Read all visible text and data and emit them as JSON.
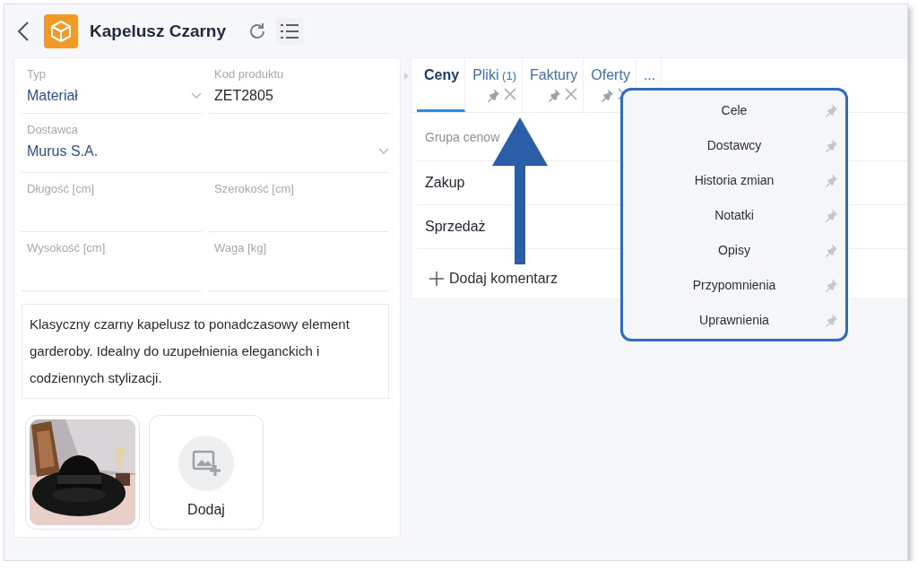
{
  "header": {
    "title": "Kapelusz Czarny"
  },
  "field_rows": [
    [
      {
        "label": "Typ",
        "kind": "select",
        "value": "Materiał"
      },
      {
        "label": "Kod produktu",
        "kind": "text",
        "value": "ZET2805"
      }
    ],
    [
      {
        "label": "Dostawca",
        "kind": "select",
        "value": "Murus S.A."
      }
    ],
    [
      {
        "label": "Długość [cm]",
        "kind": "text"
      },
      {
        "label": "Szerokość [cm]",
        "kind": "text"
      }
    ],
    [
      {
        "label": "Wysokość [cm]",
        "kind": "text"
      },
      {
        "label": "Waga [kg]",
        "kind": "text"
      }
    ]
  ],
  "description": "Klasyczny czarny kapelusz to ponadczasowy element garderoby. Idealny do uzupełnienia eleganckich i codziennych stylizacji.",
  "gallery": [
    {
      "kind": "picture"
    },
    {
      "kind": "add",
      "label": "Dodaj"
    }
  ],
  "tabs": [
    {
      "label": "Ceny",
      "selected": true,
      "closable": false
    },
    {
      "label": "Pliki",
      "count": "(1)",
      "selected": false,
      "closable": true
    },
    {
      "label": "Faktury",
      "selected": false,
      "closable": true
    },
    {
      "label": "Oferty",
      "selected": false,
      "closable": true
    },
    {
      "label": "...",
      "selected": false,
      "closable": false
    }
  ],
  "rows": [
    {
      "label": "Grupa cenow",
      "kind": "header"
    },
    {
      "label": "Zakup",
      "kind": "row"
    },
    {
      "label": "Sprzedaż",
      "kind": "row"
    }
  ],
  "add_comment": "Dodaj komentarz",
  "menu": [
    "Cele",
    "Dostawcy",
    "Historia zmian",
    "Notatki",
    "Opisy",
    "Przypomnienia",
    "Uprawnienia"
  ]
}
